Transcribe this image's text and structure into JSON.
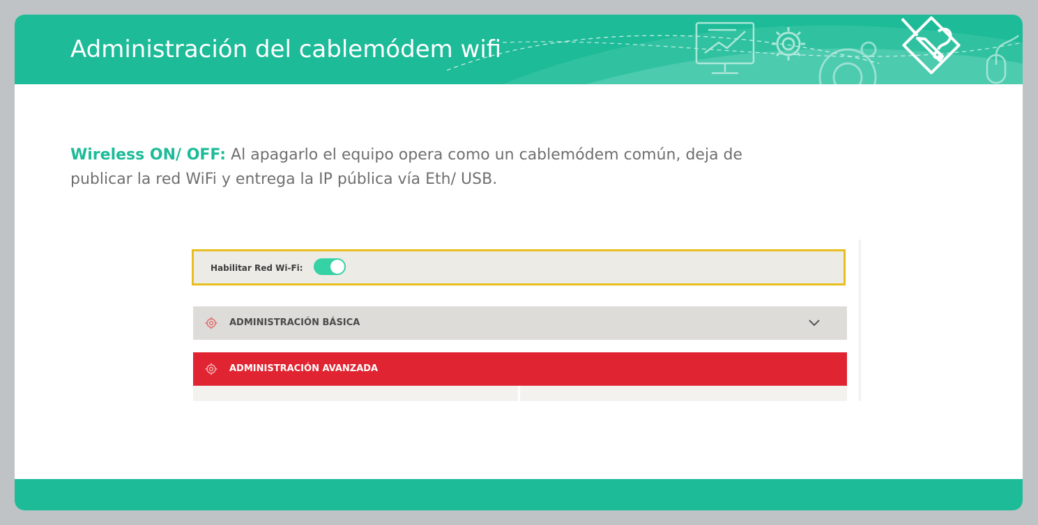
{
  "slide": {
    "title": "Administración del cablemódem wifi",
    "body_keyword": "Wireless ON/ OFF:",
    "body_text": " Al apagarlo el equipo opera como un cablemódem común, deja de publicar la red WiFi y entrega la IP pública vía Eth/ USB."
  },
  "screenshot": {
    "wifi_label": "Habilitar Red Wi-Fi:",
    "wifi_enabled": true,
    "accordion": [
      {
        "label": "ADMINISTRACIÓN BÁSICA",
        "expanded": false
      },
      {
        "label": "ADMINISTRACIÓN AVANZADA",
        "expanded": true
      }
    ]
  },
  "colors": {
    "brand_green": "#1dbb98",
    "toggle_on": "#34d2a4",
    "highlight_border": "#e8be1e",
    "advanced_red": "#e02431"
  },
  "icons": [
    "computer-icon",
    "gear-icon",
    "mouse-icon",
    "tools-logo-icon",
    "settings-gear-icon",
    "chevron-down-icon"
  ]
}
